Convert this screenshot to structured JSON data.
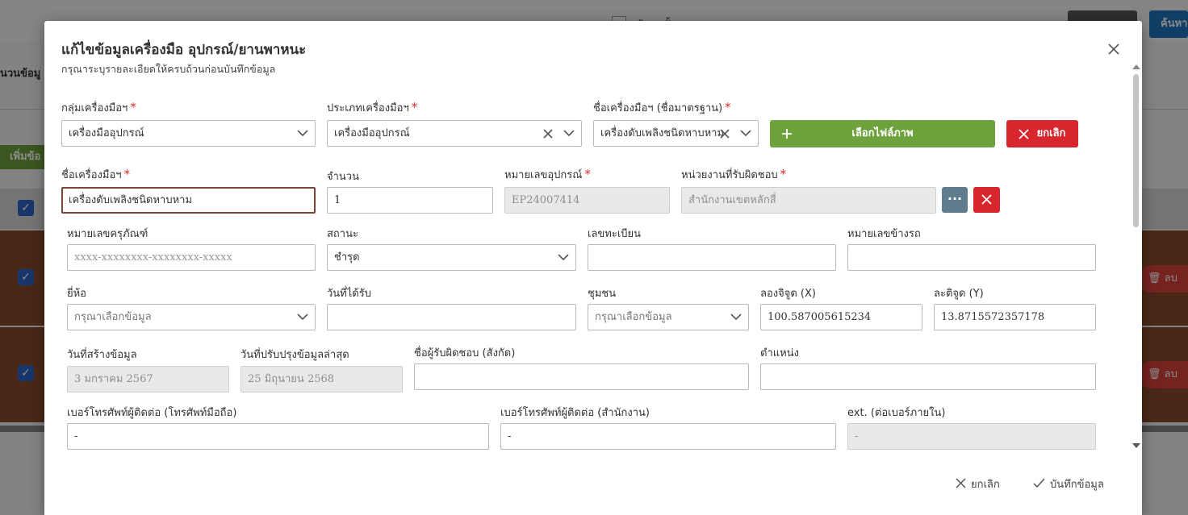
{
  "background": {
    "header_checkbox_label": "ข้อมูลทั้งหมด",
    "btn_search": "ค้นหา",
    "left_text_1": "นวนข้อมู",
    "add_button": "เพิ่มข้อ",
    "delete_label": "ลบ"
  },
  "modal": {
    "title": "แก้ไขข้อมูลเครื่องมือ อุปกรณ์/ยานพาหนะ",
    "subtitle": "กรุณาระบุรายละเอียดให้ครบถ้วนก่อนบันทึกข้อมูล"
  },
  "form": {
    "tool_group": {
      "label": "กลุ่มเครื่องมือฯ",
      "value": "เครื่องมืออุปกรณ์"
    },
    "tool_type": {
      "label": "ประเภทเครื่องมือฯ",
      "value": "เครื่องมืออุปกรณ์"
    },
    "tool_standard_name": {
      "label": "ชื่อเครื่องมือฯ (ชื่อมาตรฐาน)",
      "value": "เครื่องดับเพลิงชนิดหาบหาม"
    },
    "select_image_button": "เลือกไฟล์ภาพ",
    "cancel_image_button": "ยกเลิก",
    "tool_name": {
      "label": "ชื่อเครื่องมือฯ",
      "value": "เครื่องดับเพลิงชนิดหาบหาม"
    },
    "quantity": {
      "label": "จำนวน",
      "value": "1"
    },
    "equipment_number": {
      "label": "หมายเลขอุปกรณ์",
      "value": "EP24007414"
    },
    "responsible_unit": {
      "label": "หน่วยงานที่รับผิดชอบ",
      "value": "สำนักงานเขตหลักสี่",
      "more_label": "···"
    },
    "asset_number": {
      "label": "หมายเลขครุภัณฑ์",
      "placeholder": "xxxx-xxxxxxxx-xxxxxxxx-xxxxx"
    },
    "status": {
      "label": "สถานะ",
      "value": "ชำรุด"
    },
    "registration_number": {
      "label": "เลขทะเบียน",
      "value": ""
    },
    "side_number": {
      "label": "หมายเลขข้างรถ",
      "value": ""
    },
    "brand": {
      "label": "ยี่ห้อ",
      "value": "กรุณาเลือกข้อมูล"
    },
    "received_date": {
      "label": "วันที่ได้รับ",
      "value": ""
    },
    "community": {
      "label": "ชุมชน",
      "value": "กรุณาเลือกข้อมูล"
    },
    "longitude": {
      "label": "ลองจิจูด (X)",
      "value": "100.587005615234"
    },
    "latitude": {
      "label": "ละติจูด (Y)",
      "value": "13.8715572357178"
    },
    "created_date": {
      "label": "วันที่สร้างข้อมูล",
      "value": "3 มกราคม 2567"
    },
    "updated_date": {
      "label": "วันที่ปรับปรุงข้อมูลล่าสุด",
      "value": "25 มิถุนายน 2568"
    },
    "responsible_person": {
      "label": "ชื่อผู้รับผิดชอบ (สังกัด)",
      "value": ""
    },
    "position": {
      "label": "ตำแหน่ง",
      "value": ""
    },
    "mobile_phone": {
      "label": "เบอร์โทรศัพท์ผู้ติดต่อ (โทรศัพท์มือถือ)",
      "value": "-"
    },
    "office_phone": {
      "label": "เบอร์โทรศัพท์ผู้ติดต่อ (สำนักงาน)",
      "value": "-"
    },
    "extension": {
      "label": "ext. (ต่อเบอร์ภายใน)",
      "value": "-"
    }
  },
  "footer": {
    "cancel": "ยกเลิก",
    "save": "บันทึกข้อมูล"
  },
  "colors": {
    "green": "#6ea23c",
    "red": "#d7262d",
    "slate": "#5f7d8d",
    "focus": "#7a4532",
    "required": "#e0292b"
  }
}
